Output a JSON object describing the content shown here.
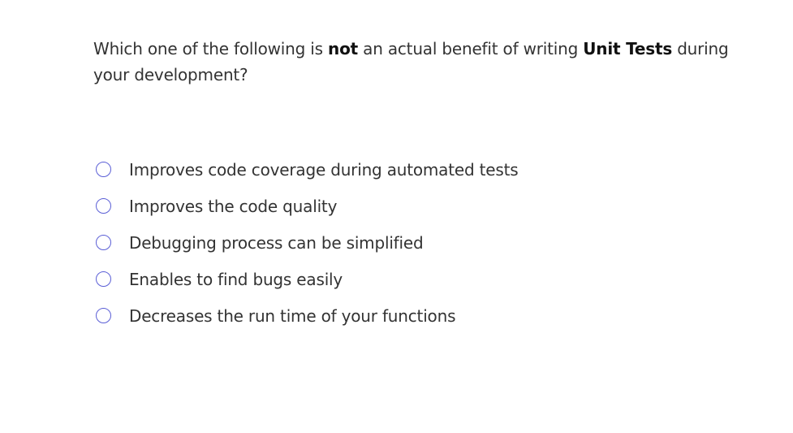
{
  "question": {
    "part1": "Which one of the following is ",
    "emphasis1": "not",
    "part2": " an actual benefit of writing ",
    "emphasis2": "Unit Tests",
    "part3": " during your development?"
  },
  "options": [
    {
      "label": "Improves code coverage during automated tests",
      "selected": false
    },
    {
      "label": "Improves the code quality",
      "selected": false
    },
    {
      "label": "Debugging process can be simplified",
      "selected": false
    },
    {
      "label": "Enables to find bugs easily",
      "selected": false
    },
    {
      "label": "Decreases the run time of your functions",
      "selected": false
    }
  ],
  "colors": {
    "radio_border": "#5b5fd6",
    "text": "#333333"
  }
}
